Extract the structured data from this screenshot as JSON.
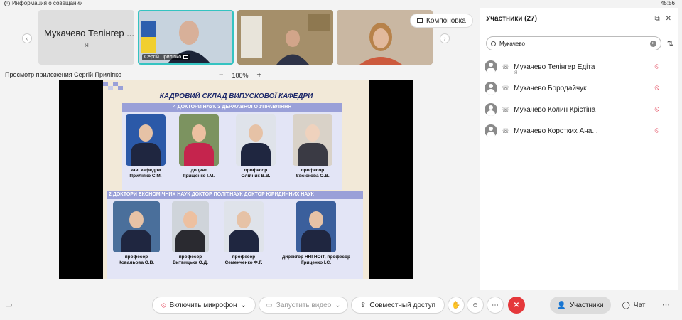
{
  "topbar": {
    "info": "Информация о совещании",
    "clock": "45:56"
  },
  "thumbs": {
    "first_name": "Мукачево Телінгер ...",
    "first_sub": "Я",
    "active_label": "Сергій Приліпко"
  },
  "layout_button": "Компоновка",
  "app": {
    "title": "Просмотр приложения Сергій Приліпко",
    "zoom": "100%",
    "minus": "−",
    "plus": "+"
  },
  "slide": {
    "title": "КАДРОВИЙ СКЛАД ВИПУСКОВОЇ КАФЕДРИ",
    "band1": "4 ДОКТОРИ НАУК З ДЕРЖАВНОГО УПРАВЛІННЯ",
    "band2": "2 ДОКТОРИ ЕКОНОМІЧНИХ НАУК   ДОКТОР ПОЛІТ.НАУК  ДОКТОР ЮРИДИЧНИХ НАУК",
    "row1": [
      {
        "role": "зав. кафедри",
        "name": "Приліпко С.М."
      },
      {
        "role": "доцент",
        "name": "Грищенко І.М."
      },
      {
        "role": "професор",
        "name": "Олійник В.В."
      },
      {
        "role": "професор",
        "name": "Євсюкова О.В."
      }
    ],
    "row2": [
      {
        "role": "професор",
        "name": "Ковальова О.В."
      },
      {
        "role": "професор",
        "name": "Витвицька О.Д."
      },
      {
        "role": "професор",
        "name": "Семенченко Ф.Г."
      },
      {
        "role": "директор ННІ НОіТ, професор",
        "name": "Гриценко І.С."
      }
    ]
  },
  "sidebar": {
    "title": "Участники (27)",
    "search_value": "Мукачево",
    "participants": [
      {
        "name": "Мукачево Телінгер Едіта",
        "sub": "Я"
      },
      {
        "name": "Мукачево Бородайчук",
        "sub": ""
      },
      {
        "name": "Мукачево Колин Крістіна",
        "sub": ""
      },
      {
        "name": "Мукачево Коротких Ана...",
        "sub": ""
      }
    ]
  },
  "toolbar": {
    "mic": "Включить микрофон",
    "video": "Запустить видео",
    "share": "Совместный доступ",
    "participants": "Участники",
    "chat": "Чат"
  },
  "colors": {
    "accent": "#35c3c1",
    "end_call": "#e5383b",
    "band": "#9aa0d8",
    "slide_title": "#1f2a6b"
  }
}
